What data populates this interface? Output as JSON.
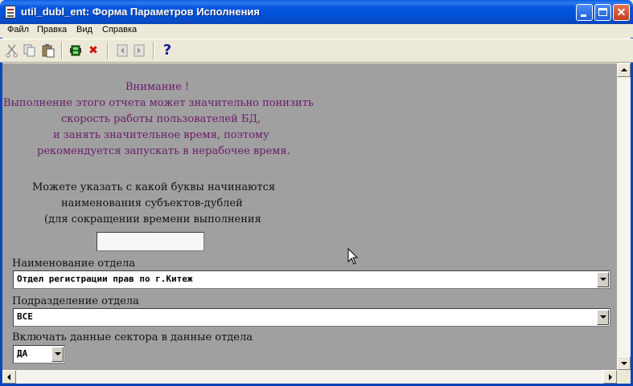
{
  "window": {
    "title": "util_dubl_ent: Форма Параметров Исполнения",
    "controls": {
      "minimize": "minimize-icon",
      "maximize": "maximize-icon",
      "close": "✕"
    }
  },
  "menu": {
    "items": [
      {
        "label": "Файл"
      },
      {
        "label": "Правка"
      },
      {
        "label": "Вид"
      },
      {
        "label": "Справка"
      }
    ]
  },
  "toolbar": {
    "icons": [
      "cut-icon",
      "copy-icon",
      "paste-icon",
      "run-icon",
      "cancel-icon",
      "prev-icon",
      "next-icon",
      "help-icon"
    ],
    "help_glyph": "?",
    "cancel_glyph": "✖"
  },
  "form": {
    "warning": {
      "line1": "Внимание !",
      "line2": "Выполнение этого отчета может значительно понизить",
      "line3": "скорость работы пользователей БД,",
      "line4": "и занять значительное время, поэтому",
      "line5": "рекомендуется запускать в нерабочее время."
    },
    "hint": {
      "line1": "Можете указать с какой буквы начинаются",
      "line2": "наименования субъектов-дублей",
      "line3": "(для сокращении времени выполнения"
    },
    "letter_input": {
      "value": ""
    },
    "department": {
      "label": "Наименование отдела",
      "value": "Отдел регистрации прав по  г.Китеж"
    },
    "subdivision": {
      "label": "Подразделение отдела",
      "value": "ВСЕ"
    },
    "include_sector": {
      "label": "Включать данные сектора в данные отдела",
      "value": "ДА"
    }
  },
  "colors": {
    "client_bg": "#A0A0A0",
    "warning_text": "#6A1A6A",
    "titlebar": "#0A5FE5"
  }
}
